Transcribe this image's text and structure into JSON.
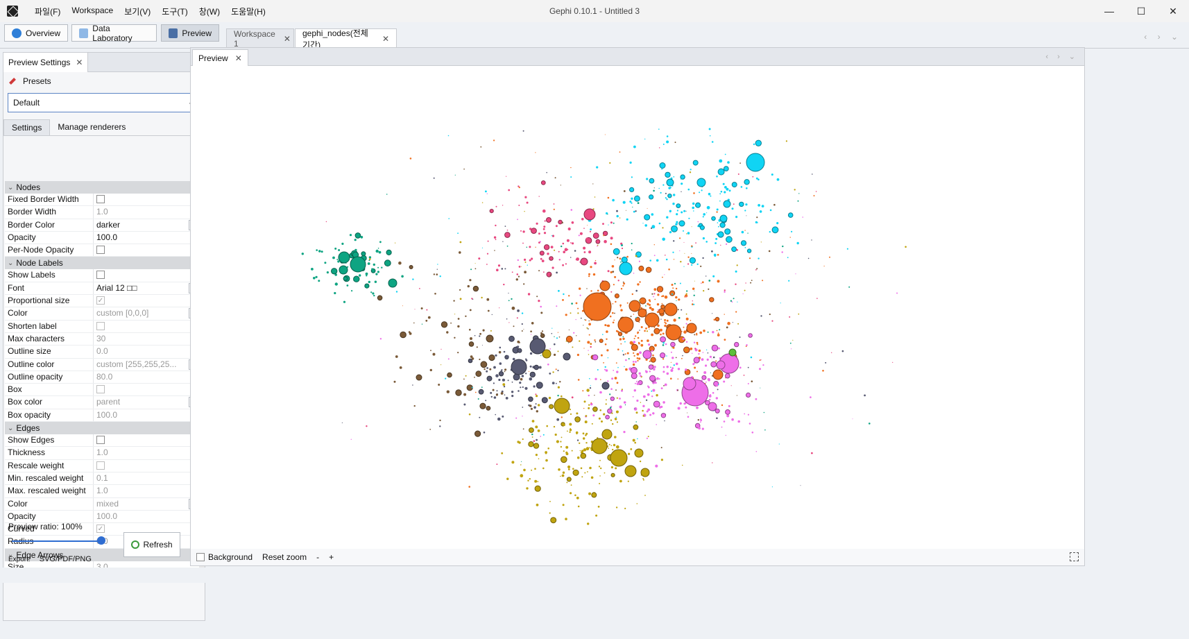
{
  "window": {
    "title": "Gephi 0.10.1 - Untitled 3",
    "menu": [
      "파일(F)",
      "Workspace",
      "보기(V)",
      "도구(T)",
      "창(W)",
      "도움말(H)"
    ],
    "controls": {
      "minimize": "—",
      "maximize": "☐",
      "close": "✕"
    }
  },
  "toolbar": {
    "overview": "Overview",
    "data_lab": "Data Laboratory",
    "preview": "Preview",
    "workspace_tabs": [
      {
        "label": "Workspace 1",
        "active": false
      },
      {
        "label": "gephi_nodes(전체기간)",
        "active": true
      }
    ],
    "close_glyph": "✕",
    "nav": "‹ › ⌄"
  },
  "left_panel": {
    "tab": "Preview Settings",
    "presets_label": "Presets",
    "preset_value": "Default",
    "subtabs": [
      "Settings",
      "Manage renderers"
    ],
    "sections": {
      "nodes": {
        "title": "Nodes",
        "rows": {
          "fixed_border_width": {
            "key": "Fixed Border Width",
            "value": ""
          },
          "border_width": {
            "key": "Border Width",
            "value": "1.0"
          },
          "border_color": {
            "key": "Border Color",
            "value": "darker"
          },
          "opacity": {
            "key": "Opacity",
            "value": "100.0"
          },
          "per_node_opacity": {
            "key": "Per-Node Opacity",
            "value": ""
          }
        }
      },
      "node_labels": {
        "title": "Node Labels",
        "rows": {
          "show_labels": {
            "key": "Show Labels",
            "value": ""
          },
          "font": {
            "key": "Font",
            "value": "Arial 12 □□"
          },
          "proportional_size": {
            "key": "Proportional size",
            "value": ""
          },
          "color": {
            "key": "Color",
            "value": "custom [0,0,0]"
          },
          "shorten_label": {
            "key": "Shorten label",
            "value": ""
          },
          "max_characters": {
            "key": "Max characters",
            "value": "30"
          },
          "outline_size": {
            "key": "Outline size",
            "value": "0.0"
          },
          "outline_color": {
            "key": "Outline color",
            "value": "custom [255,255,25..."
          },
          "outline_opacity": {
            "key": "Outline opacity",
            "value": "80.0"
          },
          "box": {
            "key": "Box",
            "value": ""
          },
          "box_color": {
            "key": "Box color",
            "value": "parent"
          },
          "box_opacity": {
            "key": "Box opacity",
            "value": "100.0"
          }
        }
      },
      "edges": {
        "title": "Edges",
        "rows": {
          "show_edges": {
            "key": "Show Edges",
            "value": ""
          },
          "thickness": {
            "key": "Thickness",
            "value": "1.0"
          },
          "rescale_weight": {
            "key": "Rescale weight",
            "value": ""
          },
          "min_rescaled_weight": {
            "key": "Min. rescaled weight",
            "value": "0.1"
          },
          "max_rescaled_weight": {
            "key": "Max. rescaled weight",
            "value": "1.0"
          },
          "color": {
            "key": "Color",
            "value": "mixed"
          },
          "opacity": {
            "key": "Opacity",
            "value": "100.0"
          },
          "curved": {
            "key": "Curved",
            "value": ""
          },
          "radius": {
            "key": "Radius",
            "value": "0.0"
          }
        }
      },
      "edge_arrows": {
        "title": "Edge Arrows",
        "rows": {
          "size": {
            "key": "Size",
            "value": "3.0"
          }
        }
      }
    },
    "ellipsis": "...",
    "preview_ratio": "Preview ratio: 100%",
    "refresh": "Refresh",
    "export_label": "Export:",
    "export_formats": "SVG/PDF/PNG"
  },
  "main_panel": {
    "tab": "Preview",
    "bottom": {
      "background_label": "Background",
      "reset_zoom": "Reset zoom",
      "zoom_out": "-",
      "zoom_in": "+"
    }
  },
  "colors": {
    "orange": "#f07020",
    "cyan": "#10d4f4",
    "pink": "#ee6ee8",
    "olive": "#c0a410",
    "slate": "#585a72",
    "green": "#0ea482",
    "rose": "#e84880",
    "brown": "#7a5a38",
    "lime": "#5cbf3a"
  }
}
